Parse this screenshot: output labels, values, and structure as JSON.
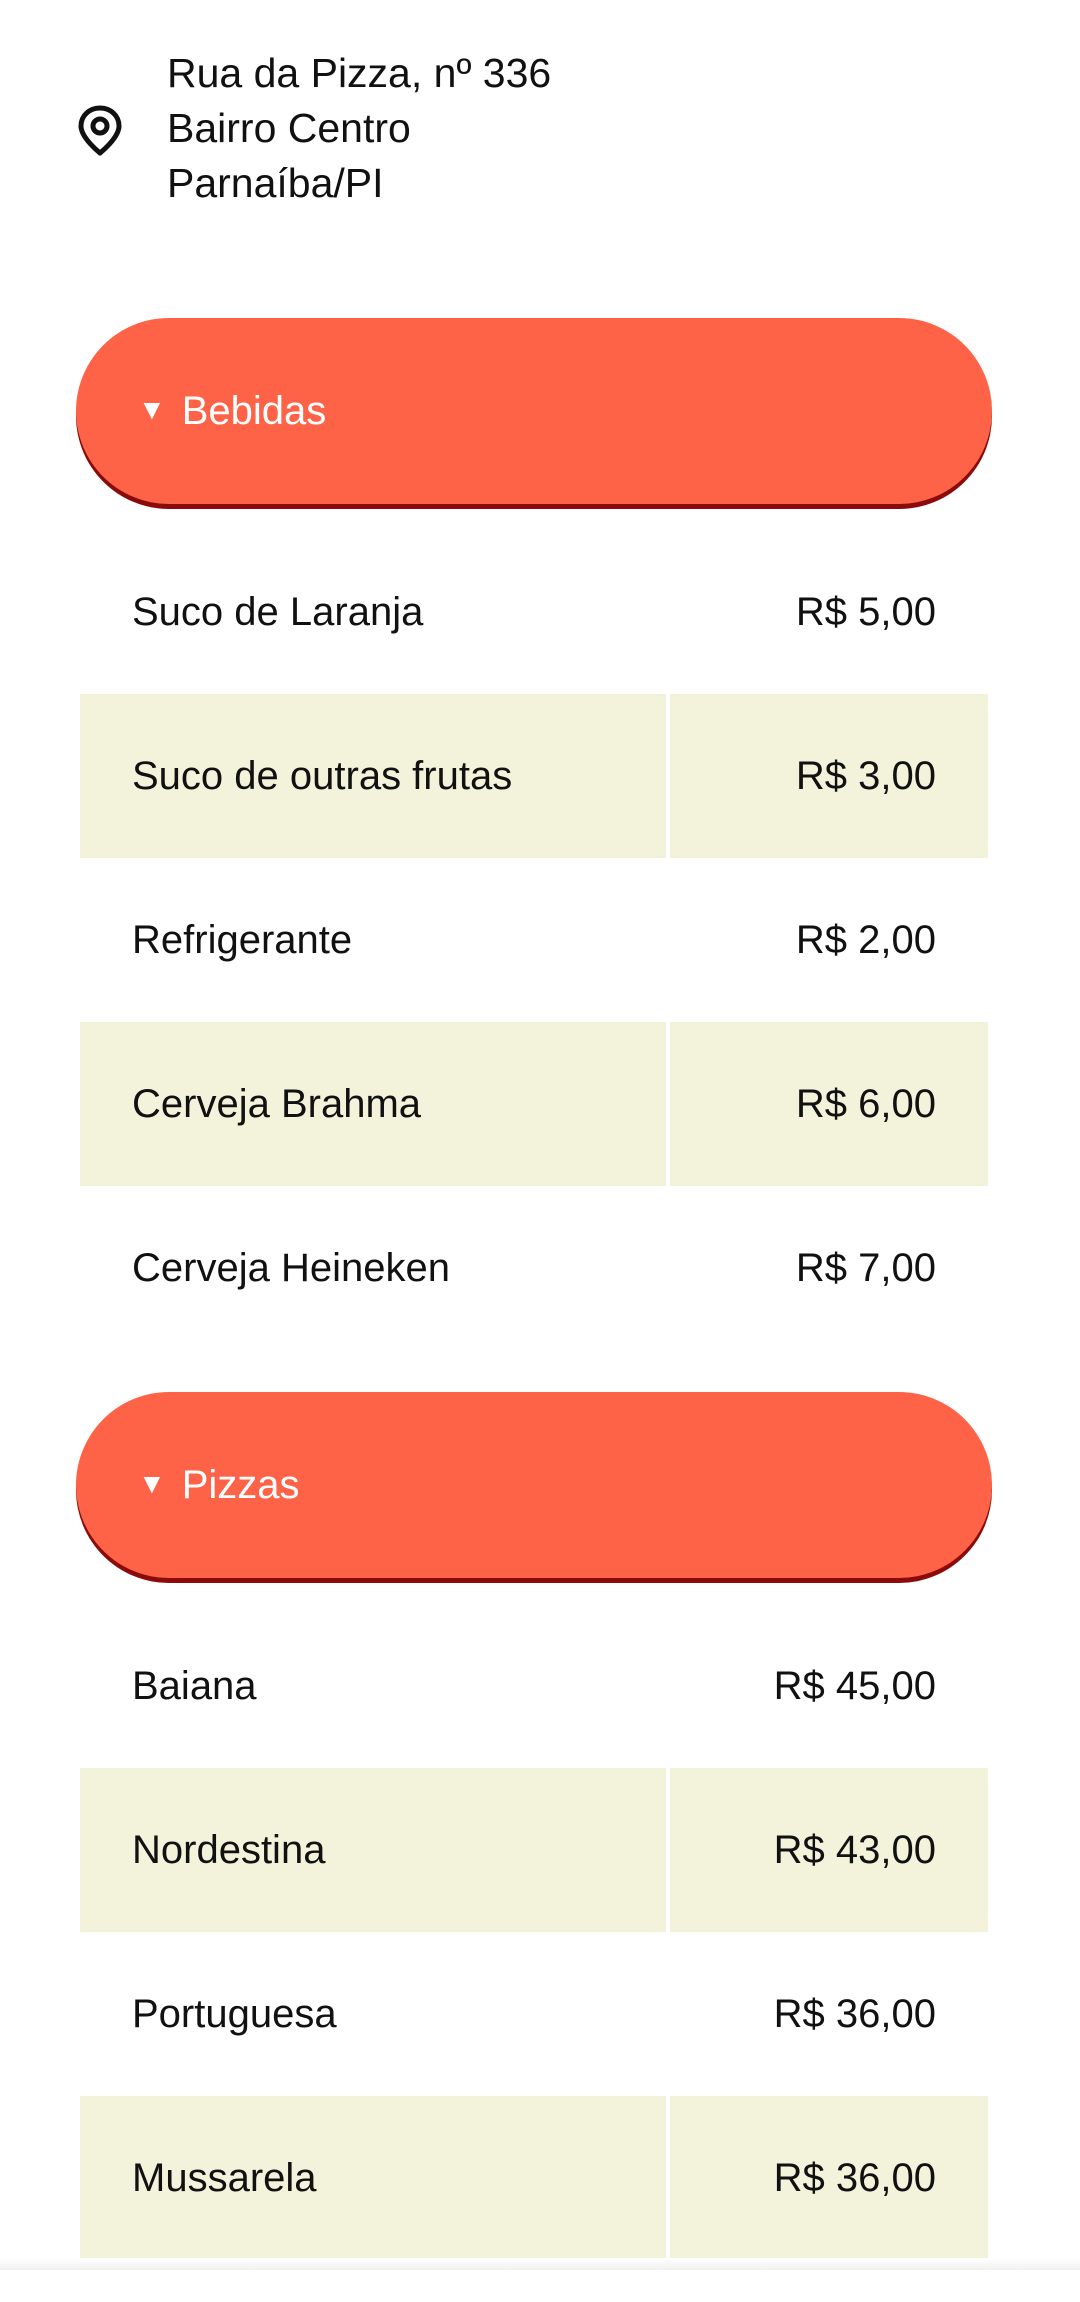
{
  "address": {
    "lines": [
      "Rua da Pizza, nº 336",
      "Bairro Centro",
      "Parnaíba/PI"
    ],
    "icon": "map-pin-icon"
  },
  "categories": [
    {
      "label": "Bebidas",
      "toggle_glyph": "▼",
      "items": [
        {
          "name": "Suco de Laranja",
          "price": "R$ 5,00"
        },
        {
          "name": "Suco de outras frutas",
          "price": "R$ 3,00"
        },
        {
          "name": "Refrigerante",
          "price": "R$ 2,00"
        },
        {
          "name": "Cerveja Brahma",
          "price": "R$ 6,00"
        },
        {
          "name": "Cerveja Heineken",
          "price": "R$ 7,00"
        }
      ]
    },
    {
      "label": "Pizzas",
      "toggle_glyph": "▼",
      "items": [
        {
          "name": "Baiana",
          "price": "R$ 45,00"
        },
        {
          "name": "Nordestina",
          "price": "R$ 43,00"
        },
        {
          "name": "Portuguesa",
          "price": "R$ 36,00"
        },
        {
          "name": "Mussarela",
          "price": "R$ 36,00"
        }
      ]
    }
  ],
  "colors": {
    "header_bg": "#ff6347",
    "header_shadow": "#8b0a0a",
    "header_text": "#ffffff",
    "alt_row_bg": "#f2f3da",
    "text": "#111111"
  }
}
